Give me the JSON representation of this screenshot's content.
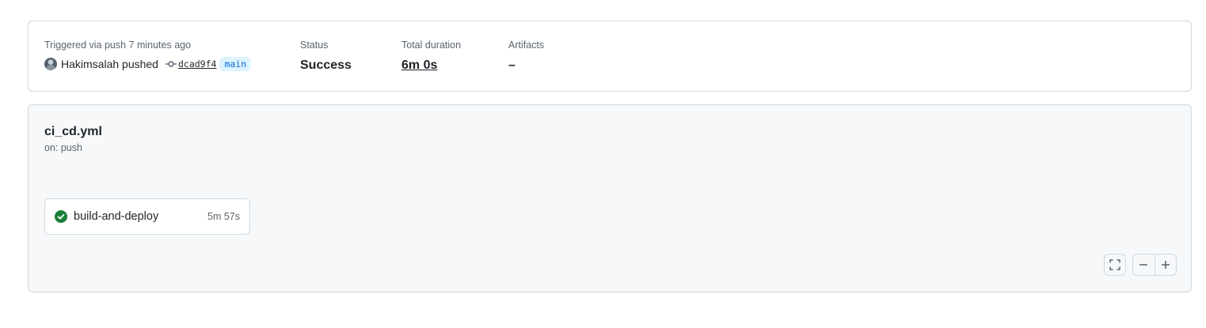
{
  "summary": {
    "trigger_label": "Triggered via push 7 minutes ago",
    "actor": "Hakimsalah pushed",
    "commit_sha": "dcad9f4",
    "branch": "main",
    "status_label": "Status",
    "status_value": "Success",
    "duration_label": "Total duration",
    "duration_value": "6m 0s",
    "artifacts_label": "Artifacts",
    "artifacts_value": "–"
  },
  "workflow": {
    "file_name": "ci_cd.yml",
    "trigger": "on: push"
  },
  "jobs": [
    {
      "name": "build-and-deploy",
      "duration": "5m 57s",
      "status": "success",
      "status_icon": "check-circle-icon"
    }
  ],
  "controls": {
    "fullscreen_icon": "fullscreen-icon",
    "zoom_out_icon": "minus-icon",
    "zoom_in_icon": "plus-icon"
  },
  "colors": {
    "success": "#1a7f37",
    "branch_text": "#0969da",
    "branch_bg": "#ddf4ff",
    "graph_bg": "#f6f8fa",
    "border": "#d1d9e0"
  }
}
